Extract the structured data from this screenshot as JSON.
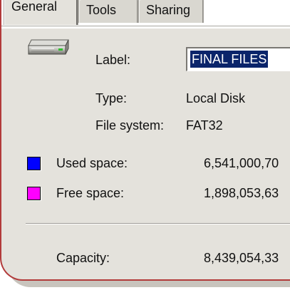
{
  "tabs": [
    {
      "label": "General",
      "active": true
    },
    {
      "label": "Tools",
      "active": false
    },
    {
      "label": "Sharing",
      "active": false
    }
  ],
  "drive": {
    "icon": "hard-drive-icon",
    "label_field_label": "Label:",
    "label_value": "FINAL FILES",
    "type_label": "Type:",
    "type_value": "Local Disk",
    "filesystem_label": "File system:",
    "filesystem_value": "FAT32"
  },
  "usage": {
    "used_label": "Used space:",
    "used_value": "6,541,000,70",
    "used_color": "#0000ff",
    "free_label": "Free space:",
    "free_value": "1,898,053,63",
    "free_color": "#ff00ff",
    "capacity_label": "Capacity:",
    "capacity_value": "8,439,054,33"
  }
}
